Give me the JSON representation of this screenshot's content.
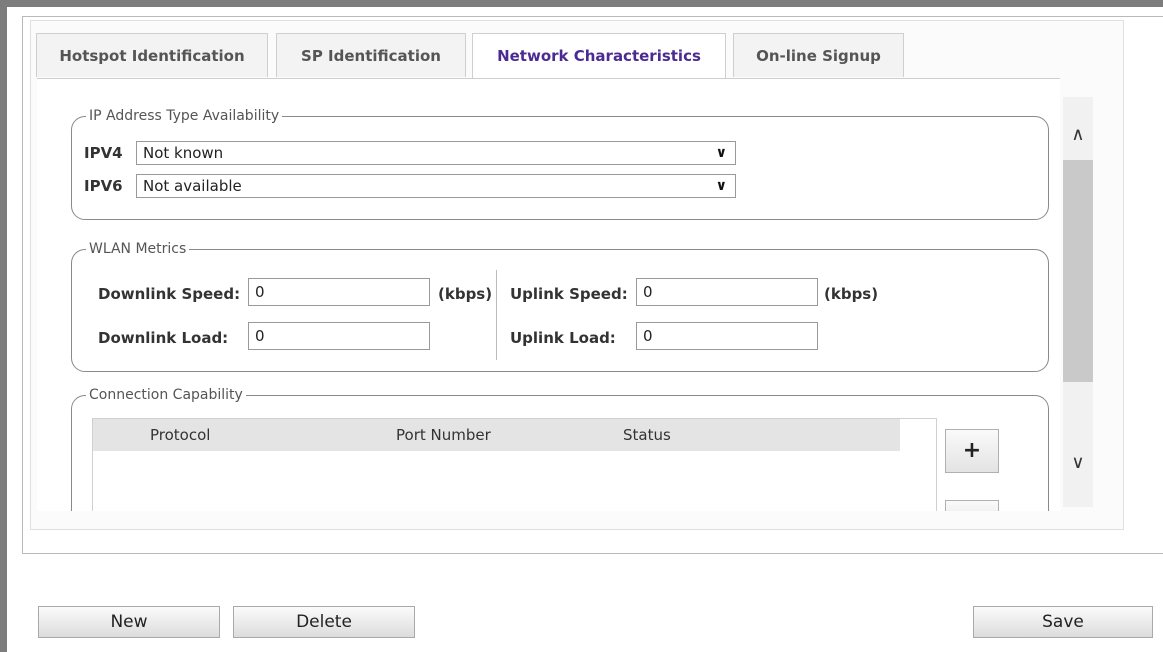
{
  "tabs": [
    {
      "label": "Hotspot Identification",
      "active": false
    },
    {
      "label": "SP Identification",
      "active": false
    },
    {
      "label": "Network Characteristics",
      "active": true
    },
    {
      "label": "On-line Signup",
      "active": false
    }
  ],
  "ip_section": {
    "legend": "IP Address Type Availability",
    "ipv4_label": "IPV4",
    "ipv4_value": "Not known",
    "ipv6_label": "IPV6",
    "ipv6_value": "Not available"
  },
  "wlan_section": {
    "legend": "WLAN Metrics",
    "downlink_speed_label": "Downlink Speed:",
    "downlink_speed_value": "0",
    "downlink_speed_unit": "(kbps)",
    "uplink_speed_label": "Uplink Speed:",
    "uplink_speed_value": "0",
    "uplink_speed_unit": "(kbps)",
    "downlink_load_label": "Downlink Load:",
    "downlink_load_value": "0",
    "uplink_load_label": "Uplink Load:",
    "uplink_load_value": "0"
  },
  "connection_section": {
    "legend": "Connection Capability",
    "columns": [
      "Protocol",
      "Port Number",
      "Status"
    ],
    "add_button": "+"
  },
  "footer": {
    "new_label": "New",
    "delete_label": "Delete",
    "save_label": "Save"
  },
  "icons": {
    "chevron_down": "chevron-down-icon",
    "scroll_up": "chevron-up-icon",
    "scroll_down": "chevron-down-icon"
  }
}
